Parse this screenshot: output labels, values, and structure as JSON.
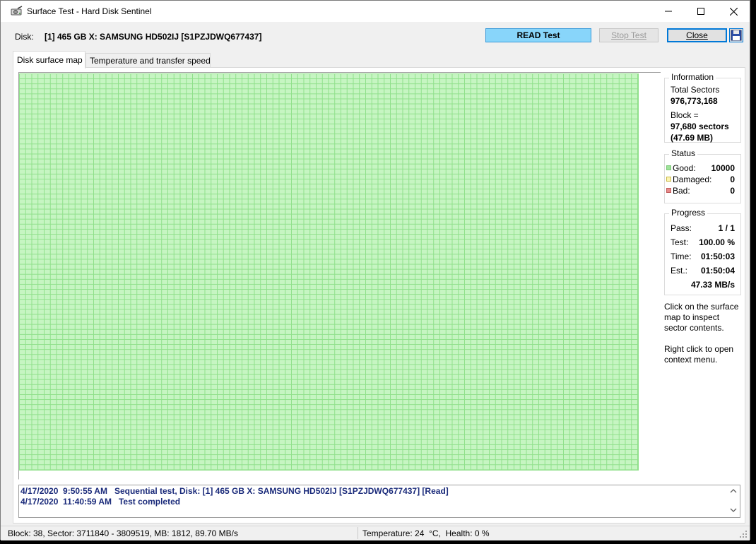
{
  "window": {
    "title": "Surface Test - Hard Disk Sentinel",
    "icons": {
      "app": "hard-disk-icon",
      "minimize": "minimize-icon",
      "maximize": "maximize-icon",
      "close": "close-icon"
    }
  },
  "toolbar": {
    "disk_label": "Disk:",
    "disk_name": "[1] 465 GB X: SAMSUNG HD502IJ [S1PZJDWQ677437]",
    "read_test_label": "READ Test",
    "stop_test_label": "Stop Test",
    "close_label": "Close",
    "save_icon": "save-icon"
  },
  "tabs": [
    {
      "label": "Disk surface map",
      "active": true
    },
    {
      "label": "Temperature and transfer speed",
      "active": false
    }
  ],
  "surface_map": {
    "cell_color": "#c6f5c2",
    "grid_color": "#8fe08a",
    "state": "all blocks good"
  },
  "information": {
    "title": "Information",
    "total_sectors_label": "Total Sectors",
    "total_sectors_value": "976,773,168",
    "block_label": "Block =",
    "block_sectors": "97,680 sectors",
    "block_size": "(47.69 MB)"
  },
  "status": {
    "title": "Status",
    "items": [
      {
        "label": "Good:",
        "value": "10000",
        "color": "#9fe39a"
      },
      {
        "label": "Damaged:",
        "value": "0",
        "color": "#f0e68c"
      },
      {
        "label": "Bad:",
        "value": "0",
        "color": "#e88a8a"
      }
    ]
  },
  "progress": {
    "title": "Progress",
    "pass_label": "Pass:",
    "pass_value": "1 / 1",
    "test_label": "Test:",
    "test_value": "100.00 %",
    "time_label": "Time:",
    "time_value": "01:50:03",
    "est_label": "Est.:",
    "est_value": "01:50:04",
    "speed_value": "47.33 MB/s"
  },
  "hints": {
    "click_hint": "Click on the surface map to inspect sector contents.",
    "right_click_hint": "Right click to open context menu."
  },
  "log": {
    "lines": [
      "4/17/2020  9:50:55 AM   Sequential test, Disk: [1] 465 GB X: SAMSUNG HD502IJ [S1PZJDWQ677437] [Read]",
      "4/17/2020  11:40:59 AM   Test completed"
    ]
  },
  "statusbar": {
    "left": "Block: 38, Sector: 3711840 - 3809519, MB: 1812, 89.70 MB/s",
    "right": "Temperature: 24  °C,  Health: 0 %"
  }
}
